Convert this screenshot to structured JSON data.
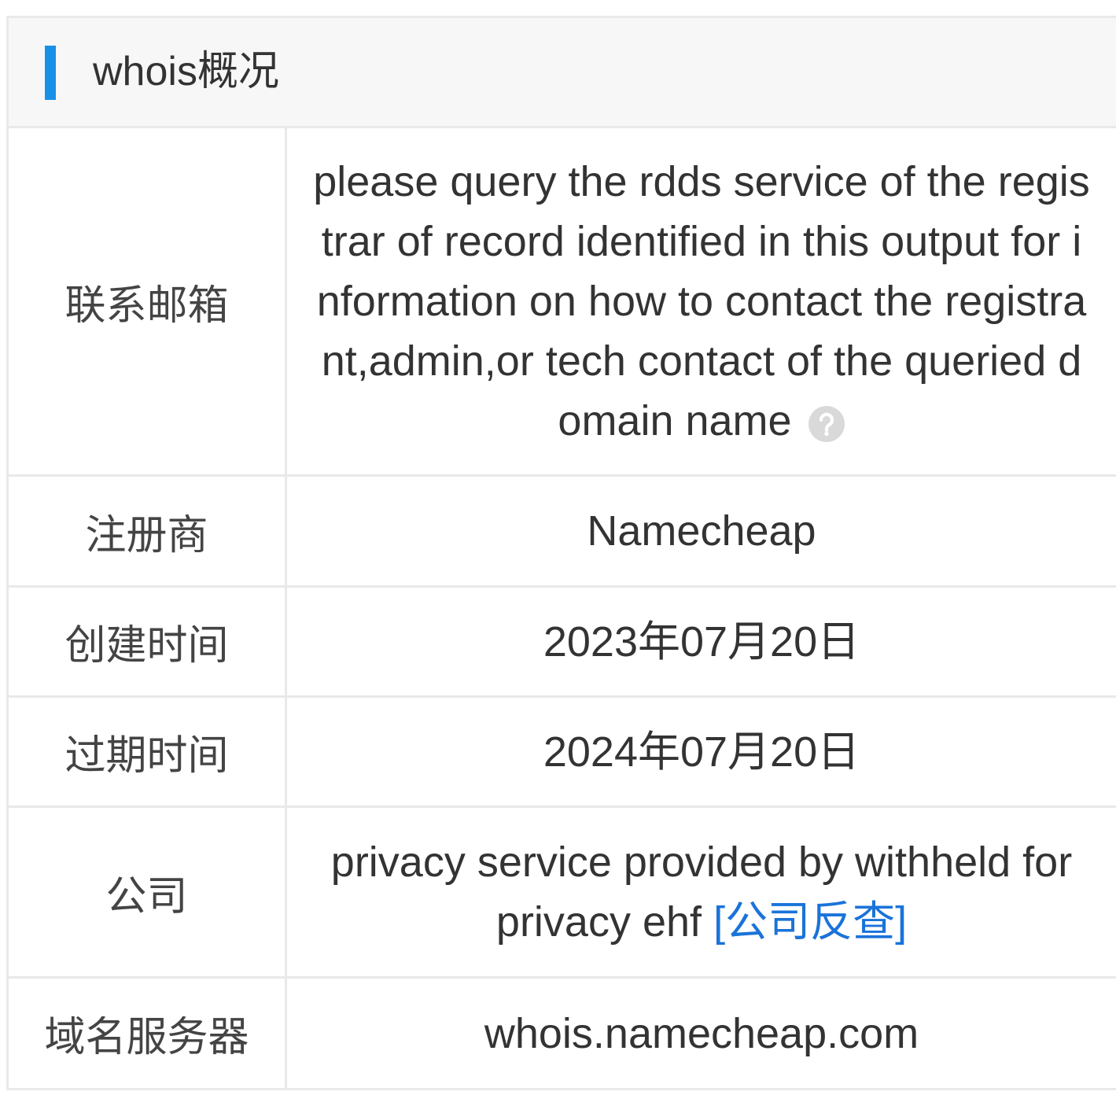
{
  "header": {
    "title": "whois概况"
  },
  "rows": [
    {
      "label": "联系邮箱",
      "value": "please query the rdds service of the registrar of record identified in this output for information on how to contact the registrant,admin,or tech contact of the queried domain name",
      "icon": "help-circle-icon"
    },
    {
      "label": "注册商",
      "value": "Namecheap"
    },
    {
      "label": "创建时间",
      "value": "2023年07月20日"
    },
    {
      "label": "过期时间",
      "value": "2024年07月20日"
    },
    {
      "label": "公司",
      "value": "privacy service provided by withheld for privacy ehf",
      "link_label": "[公司反查]"
    },
    {
      "label": "域名服务器",
      "value": "whois.namecheap.com"
    }
  ],
  "colors": {
    "accent": "#1890e8",
    "link": "#1a73d9",
    "border": "#e9e9e9",
    "header_bg": "#f7f7f7",
    "text": "#333333",
    "label": "#444444",
    "icon": "#d9d9d9"
  }
}
